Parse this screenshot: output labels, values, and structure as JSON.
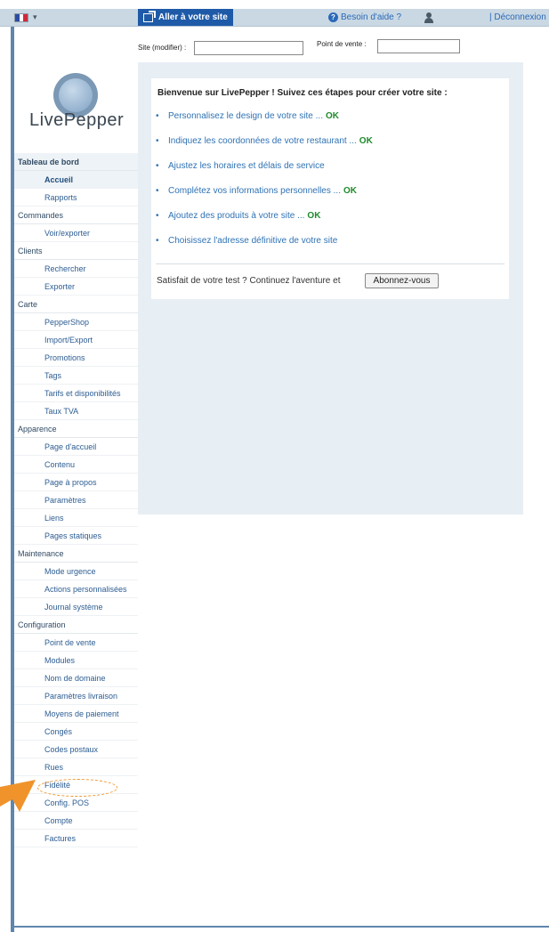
{
  "topbar": {
    "language_flag": "france-flag-icon",
    "visit_site_label": "Aller à votre site",
    "help_label": "Besoin d'aide ?",
    "logout_label": "| Déconnexion"
  },
  "filters": {
    "site_label": "Site (modifier) :",
    "site_value": "",
    "point_of_sale_label": "Point de vente :",
    "point_of_sale_value": ""
  },
  "logo": {
    "text": "LivePepper"
  },
  "sidebar": {
    "sections": [
      {
        "label": "Tableau de bord",
        "active": true,
        "items": [
          {
            "label": "Accueil",
            "active": true
          },
          {
            "label": "Rapports"
          }
        ]
      },
      {
        "label": "Commandes",
        "items": [
          {
            "label": "Voir/exporter"
          }
        ]
      },
      {
        "label": "Clients",
        "items": [
          {
            "label": "Rechercher"
          },
          {
            "label": "Exporter"
          }
        ]
      },
      {
        "label": "Carte",
        "items": [
          {
            "label": "PepperShop"
          },
          {
            "label": "Import/Export"
          },
          {
            "label": "Promotions"
          },
          {
            "label": "Tags"
          },
          {
            "label": "Tarifs et disponibilités"
          },
          {
            "label": "Taux TVA"
          }
        ]
      },
      {
        "label": "Apparence",
        "items": [
          {
            "label": "Page d'accueil"
          },
          {
            "label": "Contenu"
          },
          {
            "label": "Page à propos"
          },
          {
            "label": "Paramètres"
          },
          {
            "label": "Liens"
          },
          {
            "label": "Pages statiques"
          }
        ]
      },
      {
        "label": "Maintenance",
        "items": [
          {
            "label": "Mode urgence"
          },
          {
            "label": "Actions personnalisées"
          },
          {
            "label": "Journal système"
          }
        ]
      },
      {
        "label": "Configuration",
        "items": [
          {
            "label": "Point de vente"
          },
          {
            "label": "Modules"
          },
          {
            "label": "Nom de domaine"
          },
          {
            "label": "Paramètres livraison"
          },
          {
            "label": "Moyens de paiement"
          },
          {
            "label": "Congés"
          },
          {
            "label": "Codes postaux"
          },
          {
            "label": "Rues"
          },
          {
            "label": "Fidélité"
          },
          {
            "label": "Config. POS"
          },
          {
            "label": "Compte"
          },
          {
            "label": "Factures"
          }
        ]
      }
    ]
  },
  "welcome": {
    "title": "Bienvenue sur LivePepper ! Suivez ces étapes pour créer votre site :",
    "steps": [
      {
        "label": "Personnalisez le design de votre site ...",
        "status": "OK"
      },
      {
        "label": "Indiquez les coordonnées de votre restaurant ...",
        "status": "OK"
      },
      {
        "label": "Ajustez les horaires et délais de service",
        "status": ""
      },
      {
        "label": "Complétez vos informations personnelles ...",
        "status": "OK"
      },
      {
        "label": "Ajoutez des produits à votre site ...",
        "status": "OK"
      },
      {
        "label": "Choisissez l'adresse définitive de votre site",
        "status": ""
      }
    ],
    "footer_text": "Satisfait de votre test ? Continuez l'aventure et",
    "subscribe_label": "Abonnez-vous"
  },
  "colors": {
    "accent": "#1e5aa8",
    "link": "#2f72b4",
    "ok": "#1f8a2b",
    "panel_bg": "#e7eef4",
    "annotation": "#f0932b"
  }
}
